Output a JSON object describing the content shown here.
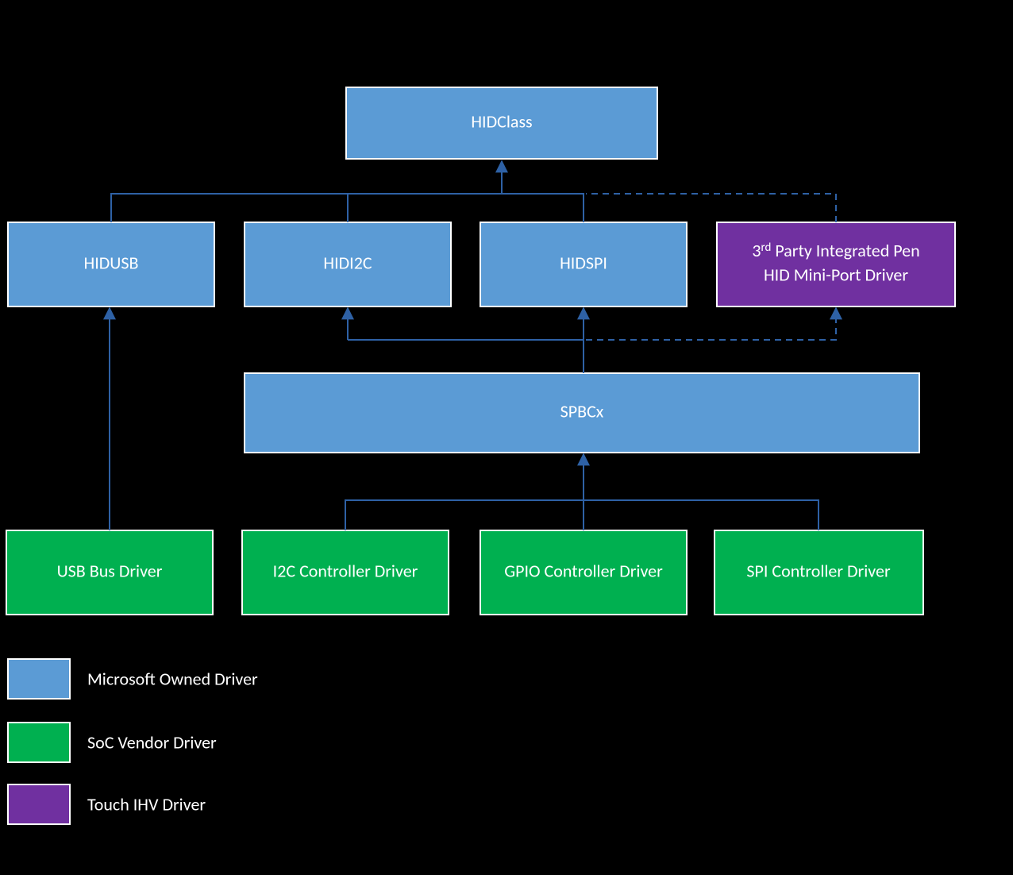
{
  "colors": {
    "blue": "#5b9bd5",
    "green": "#00b050",
    "purple": "#7030a0",
    "edge": "#2e61a5"
  },
  "nodes": {
    "hidclass": "HIDClass",
    "hidusb": "HIDUSB",
    "hidi2c": "HIDI2C",
    "hidspi": "HIDSPI",
    "third": {
      "l1": "3",
      "ord": "rd",
      "l1b": " Party Integrated Pen",
      "l2": "HID Mini-Port Driver"
    },
    "spbcx": "SPBCx",
    "usb": "USB Bus Driver",
    "i2c": "I2C Controller Driver",
    "gpio": "GPIO Controller Driver",
    "spi": "SPI Controller Driver"
  },
  "legend": {
    "blue": "Microsoft Owned Driver",
    "green": "SoC Vendor Driver",
    "purple": "Touch IHV Driver"
  }
}
